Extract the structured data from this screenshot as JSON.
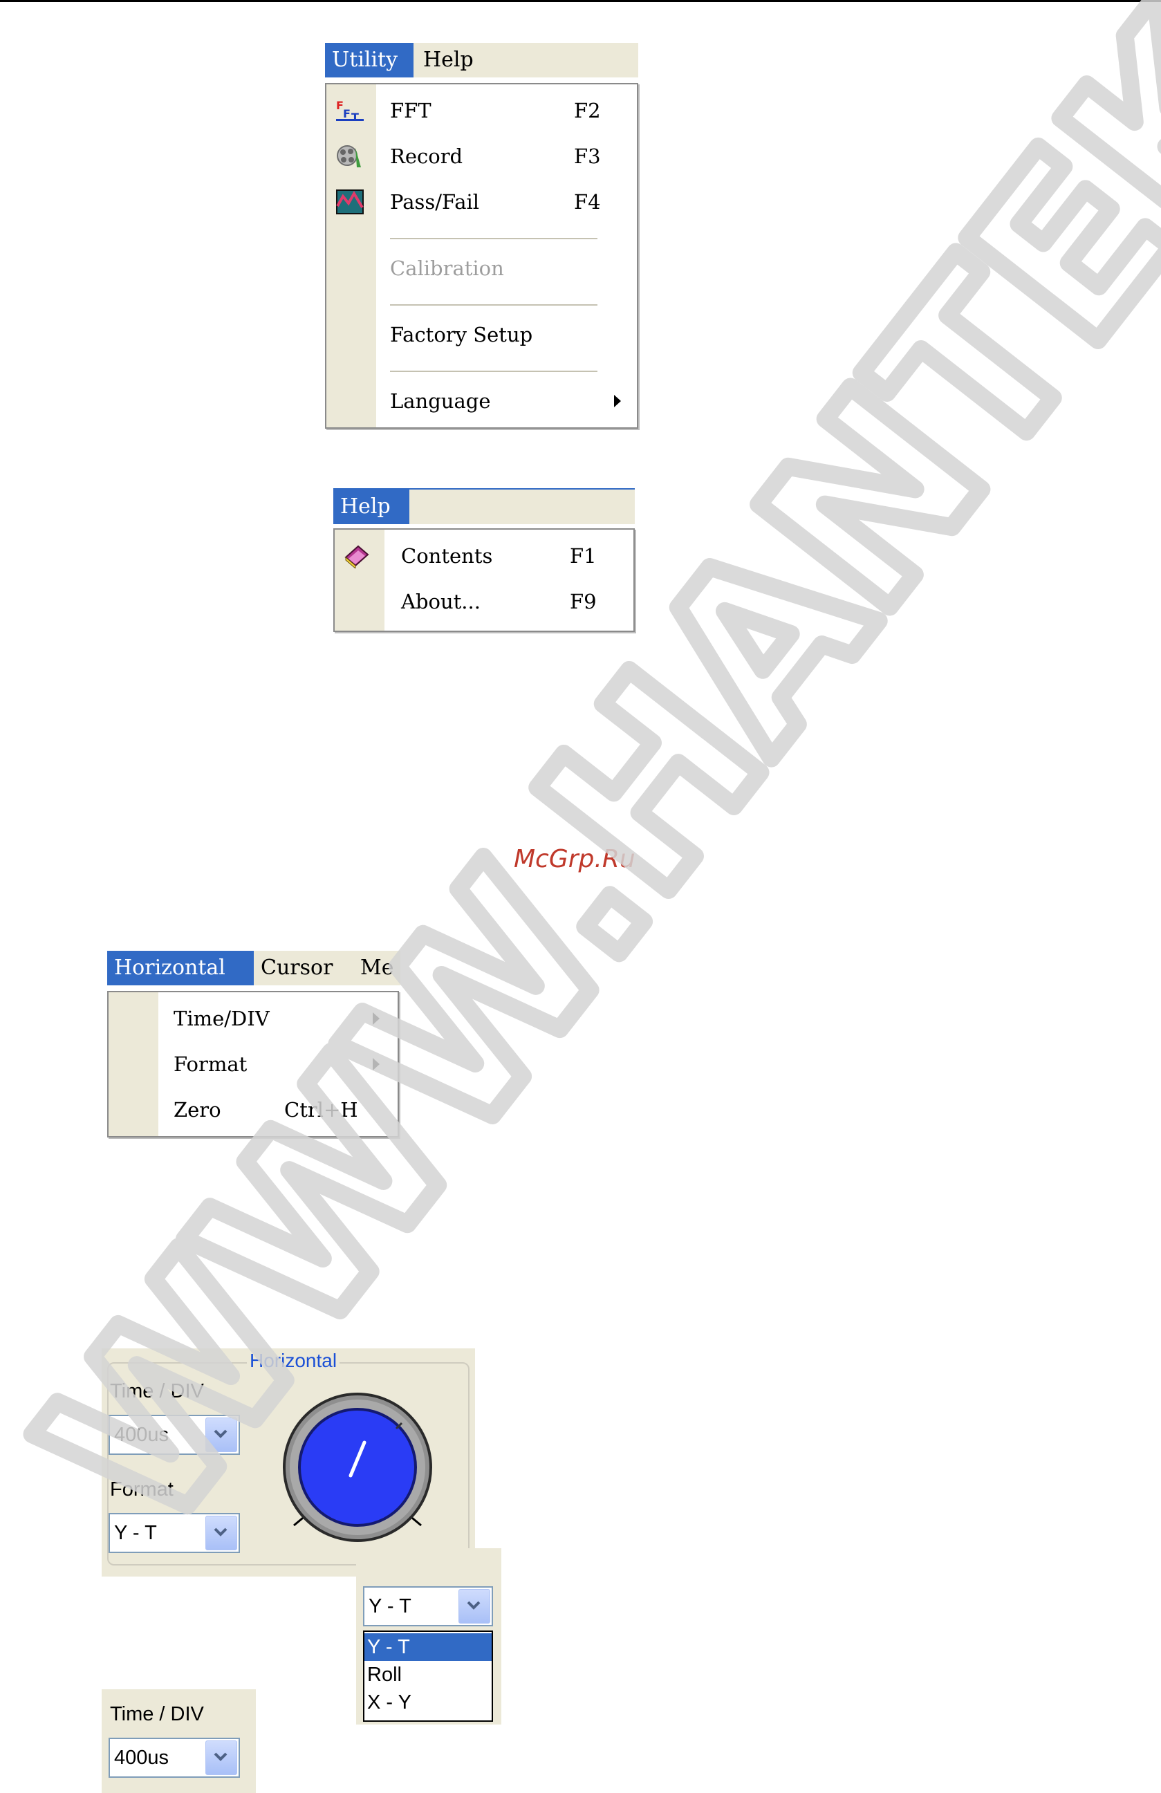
{
  "utility_menu": {
    "menubar": [
      {
        "label": "Utility",
        "active": true
      },
      {
        "label": "Help",
        "active": false
      }
    ],
    "items": [
      {
        "label": "FFT",
        "shortcut": "F2",
        "icon": "fft-icon"
      },
      {
        "label": "Record",
        "shortcut": "F3",
        "icon": "record-icon"
      },
      {
        "label": "Pass/Fail",
        "shortcut": "F4",
        "icon": "pass-fail-icon"
      },
      {
        "label": "Calibration",
        "shortcut": "",
        "disabled": true
      },
      {
        "label": "Factory Setup",
        "shortcut": ""
      },
      {
        "label": "Language",
        "shortcut": "",
        "submenu": true
      }
    ]
  },
  "help_menu": {
    "menubar": [
      {
        "label": "Help",
        "active": true
      }
    ],
    "items": [
      {
        "label": "Contents",
        "shortcut": "F1",
        "icon": "contents-book-icon"
      },
      {
        "label": "About...",
        "shortcut": "F9"
      }
    ]
  },
  "watermark_small": "McGrp.Ru",
  "horizontal_menu": {
    "menubar": [
      {
        "label": "Horizontal",
        "active": true
      },
      {
        "label": "Cursor",
        "active": false
      },
      {
        "label": "Mea",
        "active": false
      }
    ],
    "items": [
      {
        "label": "Time/DIV",
        "shortcut": "",
        "submenu": true
      },
      {
        "label": "Format",
        "shortcut": "",
        "submenu": true
      },
      {
        "label": "Zero",
        "shortcut": "Ctrl+H"
      }
    ]
  },
  "horizontal_panel": {
    "group_title": "Horizontal",
    "time_div_label": "Time / DIV",
    "time_div_value": "400us",
    "format_label": "Format",
    "format_value": "Y - T"
  },
  "format_dropdown": {
    "value": "Y - T",
    "options": [
      "Y - T",
      "Roll",
      "X - Y"
    ],
    "selected": "Y - T"
  },
  "time_div_snippet": {
    "label": "Time / DIV",
    "value": "400us"
  },
  "colors": {
    "menu_highlight": "#316ac5",
    "menu_gutter": "#ece9d8",
    "knob_blue": "#2a3cf5",
    "group_title_blue": "#1a4fd6"
  }
}
